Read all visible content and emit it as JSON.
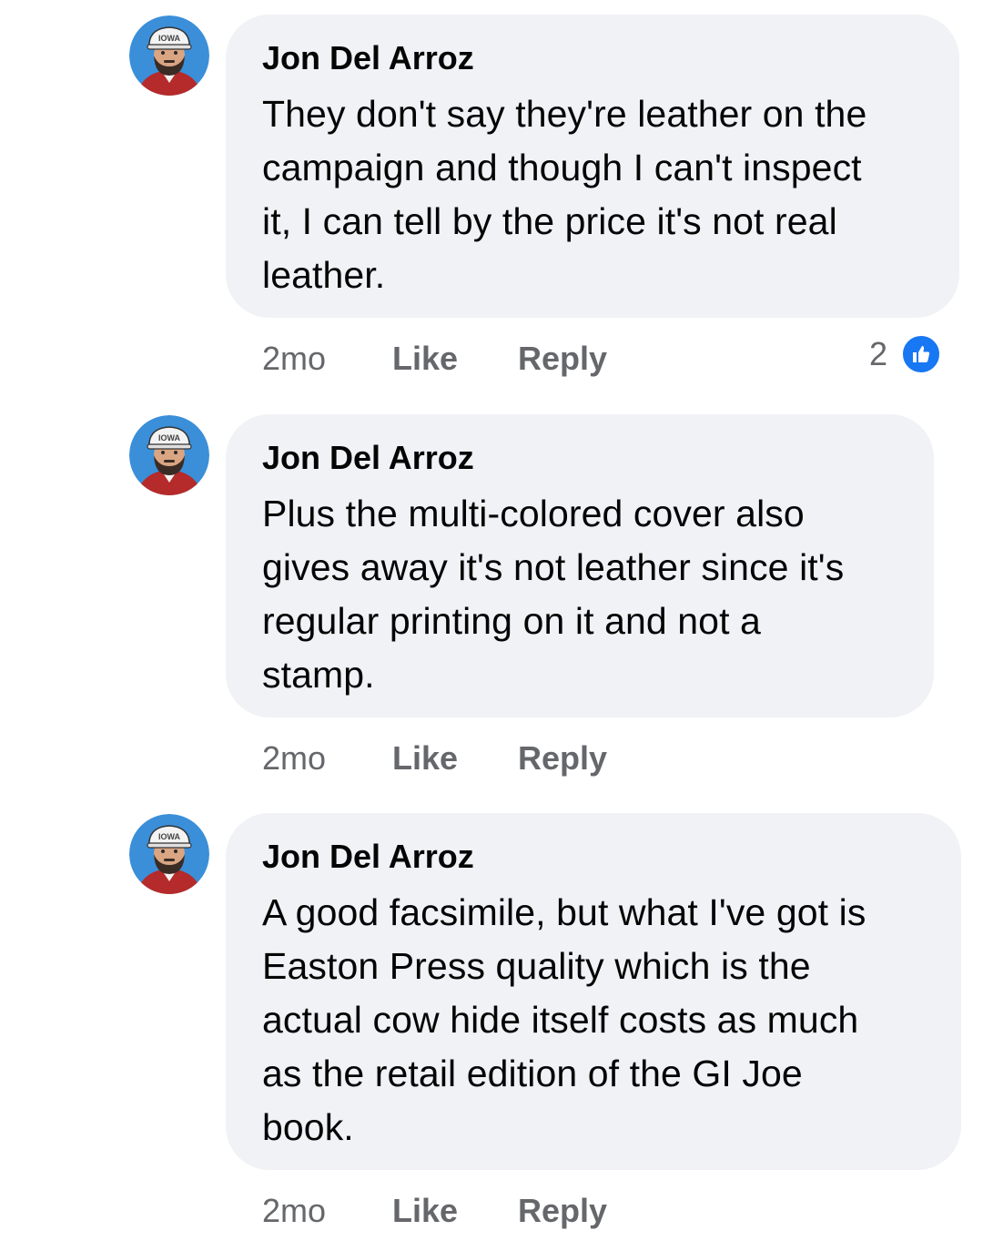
{
  "comments": [
    {
      "author": "Jon Del Arroz",
      "lines": [
        "They don't say they're leather on the",
        "campaign and though I can't inspect",
        "it, I can tell by the price it's not real",
        "leather."
      ],
      "time": "2mo",
      "like_label": "Like",
      "reply_label": "Reply",
      "reaction_count": "2",
      "reaction_icon": "thumbs-up-icon"
    },
    {
      "author": "Jon Del Arroz",
      "lines": [
        "Plus the multi-colored cover also",
        "gives away it's not leather since it's",
        "regular printing on it and not a",
        "stamp."
      ],
      "time": "2mo",
      "like_label": "Like",
      "reply_label": "Reply"
    },
    {
      "author": "Jon Del Arroz",
      "lines": [
        "A good facsimile, but what I've got is",
        "Easton Press quality which is the",
        "actual cow hide itself costs as much",
        "as the retail edition of the GI Joe",
        "book."
      ],
      "time": "2mo",
      "like_label": "Like",
      "reply_label": "Reply"
    }
  ],
  "avatar": {
    "hat_text": "IOWA",
    "colors": {
      "background": "#3b8fd9",
      "skin": "#d9a583",
      "beard": "#3a2c25",
      "hat": "#f3f3f3",
      "shirt": "#b52a2a"
    }
  },
  "colors": {
    "bubble": "#f0f2f5",
    "meta_text": "#65676b",
    "like_blue": "#1877f2"
  }
}
